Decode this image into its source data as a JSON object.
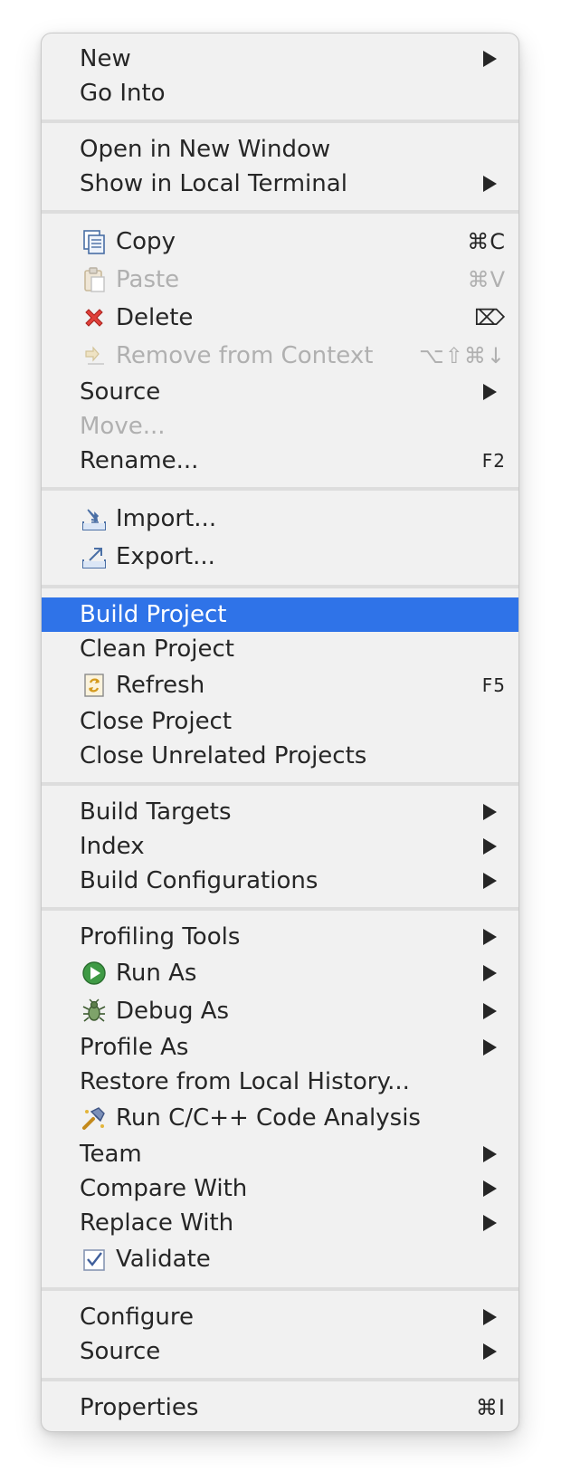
{
  "menu": {
    "group1": {
      "new": "New",
      "go_into": "Go Into"
    },
    "group2": {
      "open_new_window": "Open in New Window",
      "show_local_terminal": "Show in Local Terminal"
    },
    "group3": {
      "copy": "Copy",
      "copy_shortcut": "⌘C",
      "paste": "Paste",
      "paste_shortcut": "⌘V",
      "delete": "Delete",
      "delete_shortcut": "⌦",
      "remove_from_context": "Remove from Context",
      "remove_shortcut": "⌥⇧⌘↓",
      "source": "Source",
      "move": "Move...",
      "rename": "Rename...",
      "rename_shortcut": "F2"
    },
    "group4": {
      "import": "Import...",
      "export": "Export..."
    },
    "group5": {
      "build_project": "Build Project",
      "clean_project": "Clean Project",
      "refresh": "Refresh",
      "refresh_shortcut": "F5",
      "close_project": "Close Project",
      "close_unrelated": "Close Unrelated Projects"
    },
    "group6": {
      "build_targets": "Build Targets",
      "index": "Index",
      "build_configurations": "Build Configurations"
    },
    "group7": {
      "profiling_tools": "Profiling Tools",
      "run_as": "Run As",
      "debug_as": "Debug As",
      "profile_as": "Profile As",
      "restore_history": "Restore from Local History...",
      "run_code_analysis": "Run C/C++ Code Analysis",
      "team": "Team",
      "compare_with": "Compare With",
      "replace_with": "Replace With",
      "validate": "Validate"
    },
    "group8": {
      "configure": "Configure",
      "source": "Source"
    },
    "group9": {
      "properties": "Properties",
      "properties_shortcut": "⌘I"
    }
  },
  "colors": {
    "menu_background": "#f1f1f1",
    "highlight": "#2f73e8",
    "text": "#262626",
    "disabled_text": "#b0b0b0",
    "separator": "#dddddd"
  },
  "icons": {
    "copy": "copy-icon",
    "paste": "paste-icon",
    "delete": "delete-icon",
    "remove_from_context": "remove-context-icon",
    "import": "import-icon",
    "export": "export-icon",
    "refresh": "refresh-icon",
    "run_as": "run-icon",
    "debug_as": "bug-icon",
    "code_analysis": "code-analysis-icon",
    "validate": "checkbox-icon"
  }
}
